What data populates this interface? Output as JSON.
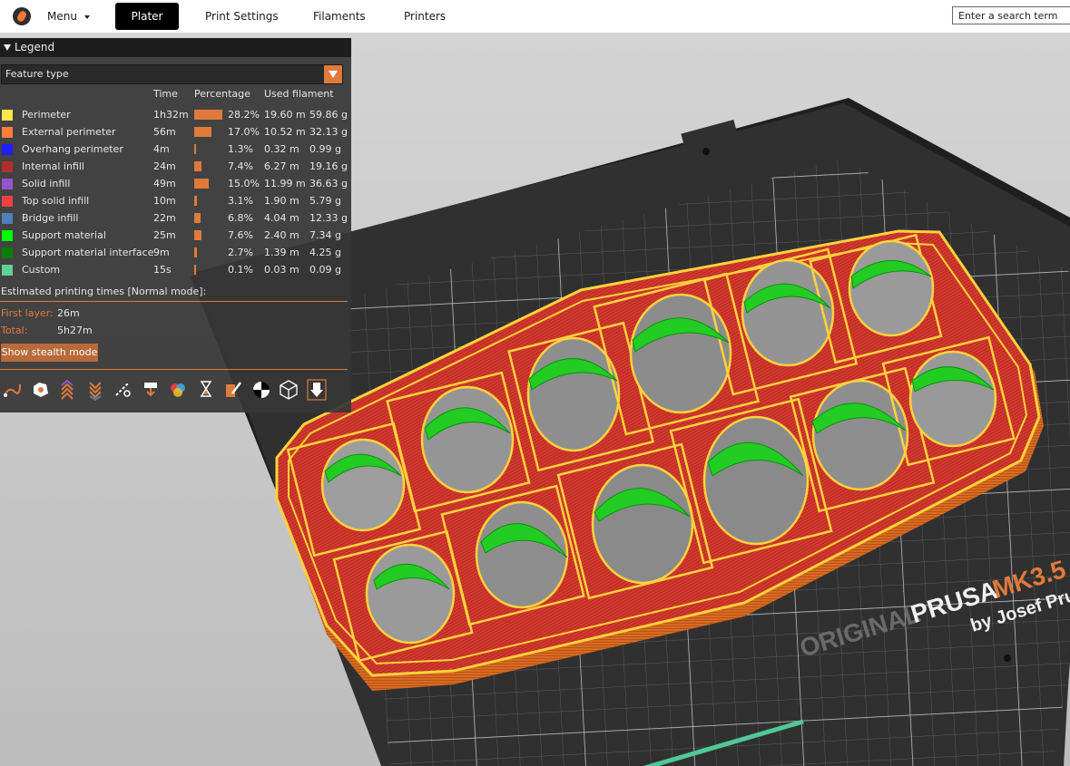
{
  "topbar": {
    "menu_label": "Menu",
    "tabs": [
      {
        "label": "Plater",
        "active": true
      },
      {
        "label": "Print Settings",
        "active": false
      },
      {
        "label": "Filaments",
        "active": false
      },
      {
        "label": "Printers",
        "active": false
      }
    ],
    "search_placeholder": "Enter a search term"
  },
  "legend": {
    "title": "Legend",
    "view_type": "Feature type",
    "columns": {
      "time": "Time",
      "percentage": "Percentage",
      "used_filament": "Used filament"
    },
    "rows": [
      {
        "name": "Perimeter",
        "color": "#ffe64d",
        "time": "1h32m",
        "pct": 28.2,
        "pct_label": "28.2%",
        "length": "19.60 m",
        "weight": "59.86 g"
      },
      {
        "name": "External perimeter",
        "color": "#ff7d38",
        "time": "56m",
        "pct": 17.0,
        "pct_label": "17.0%",
        "length": "10.52 m",
        "weight": "32.13 g"
      },
      {
        "name": "Overhang perimeter",
        "color": "#1f1fff",
        "time": "4m",
        "pct": 1.3,
        "pct_label": "1.3%",
        "length": "0.32 m",
        "weight": "0.99 g"
      },
      {
        "name": "Internal infill",
        "color": "#b03029",
        "time": "24m",
        "pct": 7.4,
        "pct_label": "7.4%",
        "length": "6.27 m",
        "weight": "19.16 g"
      },
      {
        "name": "Solid infill",
        "color": "#9654cc",
        "time": "49m",
        "pct": 15.0,
        "pct_label": "15.0%",
        "length": "11.99 m",
        "weight": "36.63 g"
      },
      {
        "name": "Top solid infill",
        "color": "#f04040",
        "time": "10m",
        "pct": 3.1,
        "pct_label": "3.1%",
        "length": "1.90 m",
        "weight": "5.79 g"
      },
      {
        "name": "Bridge infill",
        "color": "#4d80ba",
        "time": "22m",
        "pct": 6.8,
        "pct_label": "6.8%",
        "length": "4.04 m",
        "weight": "12.33 g"
      },
      {
        "name": "Support material",
        "color": "#00ff00",
        "time": "25m",
        "pct": 7.6,
        "pct_label": "7.6%",
        "length": "2.40 m",
        "weight": "7.34 g"
      },
      {
        "name": "Support material interface",
        "color": "#008000",
        "time": "9m",
        "pct": 2.7,
        "pct_label": "2.7%",
        "length": "1.39 m",
        "weight": "4.25 g"
      },
      {
        "name": "Custom",
        "color": "#5ed194",
        "time": "15s",
        "pct": 0.1,
        "pct_label": "0.1%",
        "length": "0.03 m",
        "weight": "0.09 g"
      }
    ],
    "estimated_label": "Estimated printing times [Normal mode]:",
    "first_layer_label": "First layer:",
    "first_layer_value": "26m",
    "total_label": "Total:",
    "total_value": "5h27m",
    "stealth_button": "Show stealth mode",
    "toolbar_icons": [
      "travel-icon",
      "wipe-icon",
      "retractions-icon",
      "deretractions-icon",
      "seams-icon",
      "tool-changes-icon",
      "color-changes-icon",
      "pause-icon",
      "custom-gcode-icon",
      "center-of-gravity-icon",
      "shells-icon",
      "tool-marker-icon"
    ]
  },
  "bed": {
    "brand_line1": "ORIGINAL",
    "brand_line2": "PRUSA",
    "brand_model": "MK3.5",
    "brand_by": "by Josef Prusa"
  },
  "colors": {
    "accent": "#e07a3a",
    "panel_bg": "#373737",
    "model_infill": "#d43a2f",
    "model_perimeter": "#ffe64d",
    "model_outer": "#d86a20",
    "support": "#22cc22"
  }
}
